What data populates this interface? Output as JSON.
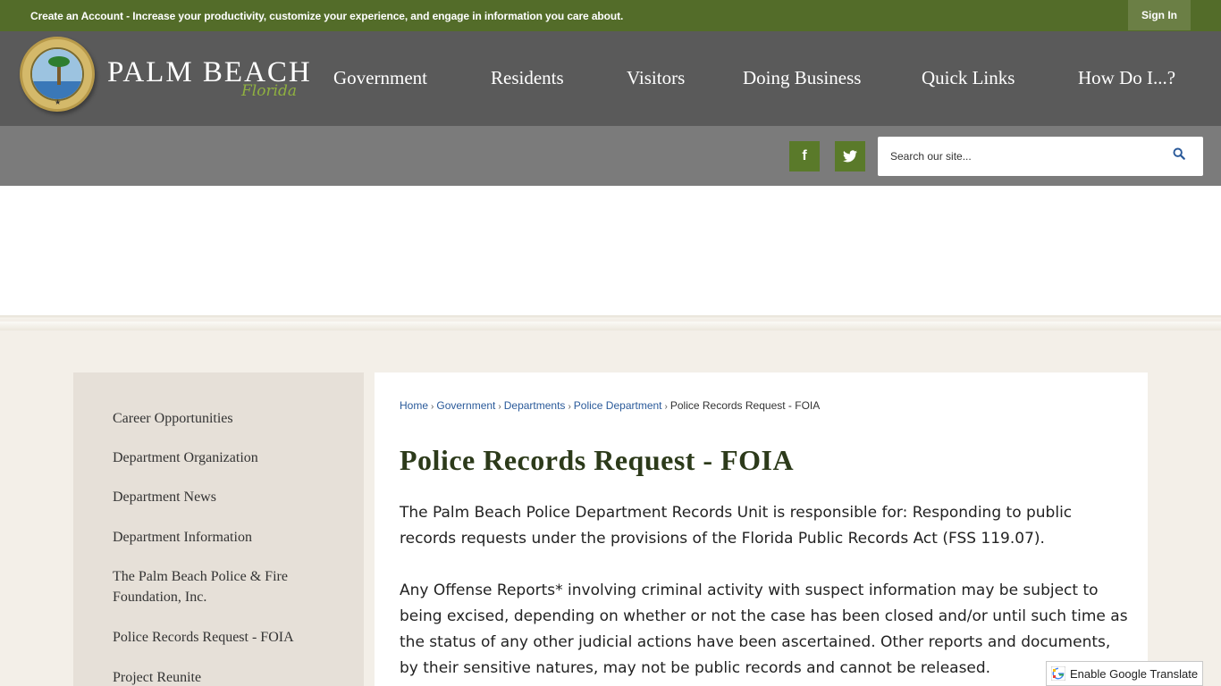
{
  "topbar": {
    "create_account": "Create an Account",
    "message": " - Increase your productivity, customize your experience, and engage in information you care about.",
    "signin_label": "Sign In"
  },
  "header": {
    "brand": "PALM BEACH",
    "brand_sub": "Florida",
    "nav": [
      "Government",
      "Residents",
      "Visitors",
      "Doing Business",
      "Quick Links",
      "How Do I...?"
    ]
  },
  "social": {
    "facebook_glyph": "f",
    "twitter_icon": "twitter-icon"
  },
  "search": {
    "placeholder": "Search our site..."
  },
  "sidebar": {
    "items": [
      "Career Opportunities",
      "Department Organization",
      "Department News",
      "Department Information",
      "The Palm Beach Police & Fire Foundation, Inc.",
      "Police Records Request - FOIA",
      "Project Reunite"
    ]
  },
  "breadcrumb": {
    "links": [
      "Home",
      "Government",
      "Departments",
      "Police Department"
    ],
    "current": "Police Records Request - FOIA"
  },
  "main": {
    "title": "Police Records Request - FOIA",
    "para1": "The Palm Beach Police Department Records Unit is responsible for:  Responding to public records requests under the provisions of the Florida Public Records Act (FSS 119.07).",
    "para2": "Any Offense Reports* involving criminal activity with suspect information may be subject to being excised, depending on whether or not the case has been closed and/or until such time as the status of any other judicial actions have been ascertained. Other reports and documents, by their sensitive natures, may not be public records and cannot be released."
  },
  "translate": {
    "label": "Enable Google Translate"
  },
  "colors": {
    "topbar": "#536c29",
    "header": "#5a5a5a",
    "subbar": "#7b7b7b",
    "social": "#5a7a2a",
    "link": "#2a5a9a"
  }
}
